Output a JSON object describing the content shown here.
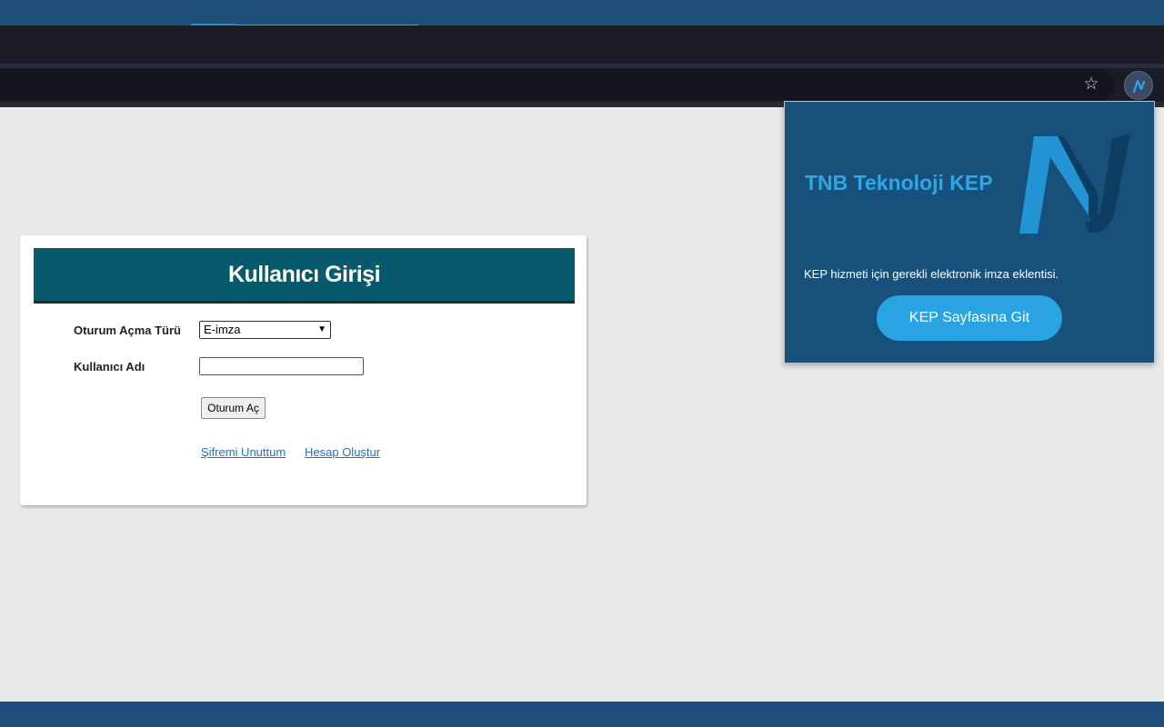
{
  "browser": {
    "bookmark_icon": "star-icon",
    "extension_icon": "tnb-extension-icon"
  },
  "login": {
    "title": "Kullanıcı Girişi",
    "session_type_label": "Oturum Açma Türü",
    "session_type_value": "E-imza",
    "username_label": "Kullanıcı Adı",
    "username_value": "",
    "submit_label": "Oturum Aç",
    "forgot_link": "Şifremi Unuttum",
    "create_link": "Hesap Oluştur"
  },
  "extension_popup": {
    "title": "TNB Teknoloji KEP",
    "description": "KEP hizmeti için gerekli elektronik imza eklentisi.",
    "button_label": "KEP Sayfasına Git",
    "logo_icon": "tnb-logo-icon"
  },
  "colors": {
    "header_bg": "#065a6b",
    "popup_bg": "#17507a",
    "accent": "#29a3e2",
    "link": "#1a73c7"
  }
}
